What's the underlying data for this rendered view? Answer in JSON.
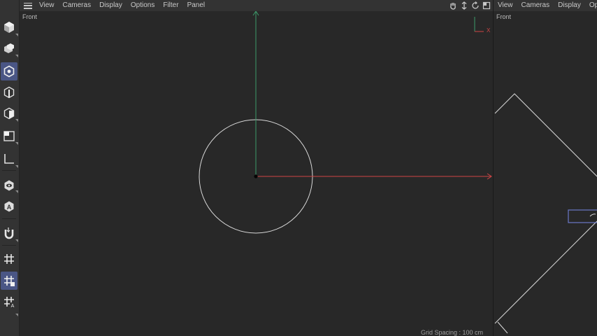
{
  "toolbar": {
    "tools": [
      {
        "name": "make-editable-icon",
        "active": false
      },
      {
        "name": "convert-object-icon",
        "active": false
      },
      {
        "name": "point-mode-icon",
        "active": true
      },
      {
        "name": "edge-mode-icon",
        "active": false
      },
      {
        "name": "polygon-mode-icon",
        "active": false
      },
      {
        "name": "texture-mode-icon",
        "active": false
      },
      {
        "name": "axis-mode-icon",
        "active": false
      },
      {
        "name": "solo-icon",
        "active": false
      },
      {
        "name": "autokey-icon",
        "active": false
      },
      {
        "name": "snap-magnet-icon",
        "active": false
      },
      {
        "name": "grid-snap-icon",
        "active": false
      },
      {
        "name": "workplane-icon",
        "active": true
      },
      {
        "name": "workplane-axis-icon",
        "active": false
      }
    ]
  },
  "main_viewport": {
    "menu": [
      "View",
      "Cameras",
      "Display",
      "Options",
      "Filter",
      "Panel"
    ],
    "label": "Front",
    "grid_spacing": "Grid Spacing : 100 cm",
    "axis_x_label": "X",
    "colors": {
      "x_axis": "#d04545",
      "y_axis": "#3d9a6a",
      "circle": "#d8d8d8"
    }
  },
  "right_viewport": {
    "menu": [
      "View",
      "Cameras",
      "Display",
      "Optio"
    ],
    "label": "Front"
  },
  "nav_icons": [
    "pan-icon",
    "move-icon",
    "rotate-icon",
    "maximize-icon"
  ]
}
